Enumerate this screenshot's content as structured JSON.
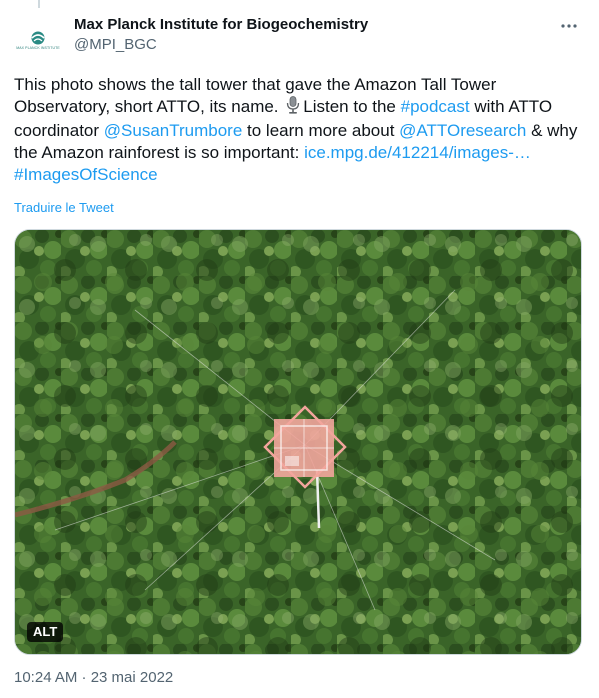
{
  "author": {
    "display_name": "Max Planck Institute for Biogeochemistry",
    "handle": "@MPI_BGC",
    "avatar_text": "MAX PLANCK INSTITUTE"
  },
  "tweet": {
    "t1": "This photo shows the tall tower that gave the Amazon Tall Tower Observatory, short ATTO, its name.",
    "mic_icon": "microphone-icon",
    "t2": "Listen to the ",
    "hashtag_podcast": "#podcast",
    "t3": " with ATTO coordinator ",
    "mention_susan": "@SusanTrumbore",
    "t4": " to learn more about ",
    "mention_atto": "@ATTOresearch",
    "t5": " & why the Amazon rainforest is so important: ",
    "link": "ice.mpg.de/412214/images-…",
    "hashtag_images": "#ImagesOfScience"
  },
  "translate_label": "Traduire le Tweet",
  "media": {
    "alt_label": "ALT"
  },
  "timestamp": "10:24 AM · 23 mai 2022",
  "colors": {
    "link": "#1d9bf0",
    "secondary_text": "#536471",
    "tower": "#f2a59c"
  }
}
